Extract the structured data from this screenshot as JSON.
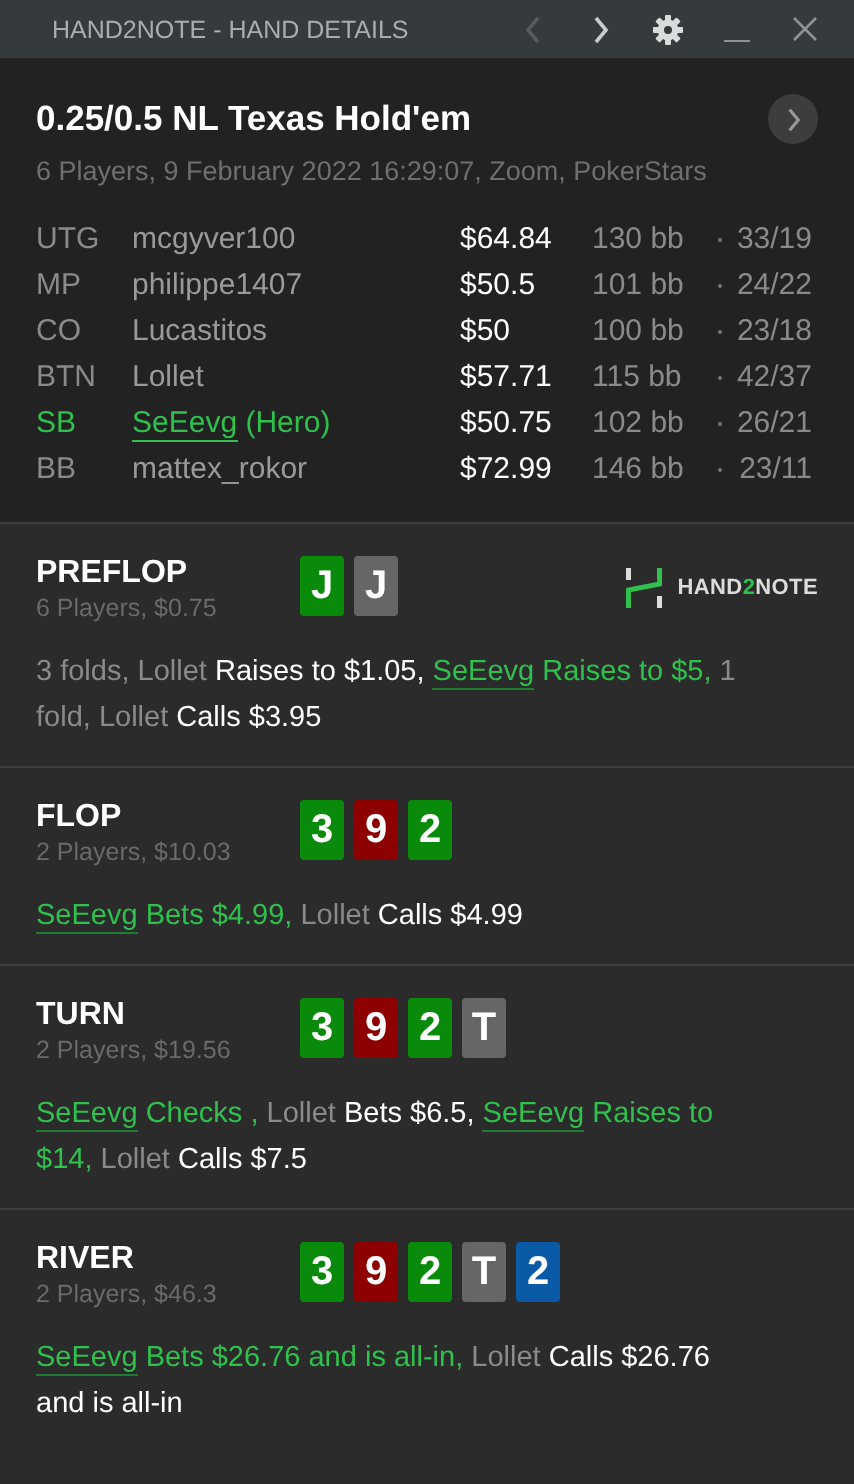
{
  "title_bar": {
    "title": "HAND2NOTE - HAND DETAILS",
    "back_disabled": true,
    "forward_disabled": false
  },
  "hand": {
    "title": "0.25/0.5 NL Texas Hold'em",
    "subtitle": "6 Players, 9 February 2022 16:29:07, Zoom, PokerStars",
    "players": [
      {
        "position": "UTG",
        "name": "mcgyver100",
        "hero": false,
        "stack": "$64.84",
        "bb": "130 bb",
        "stats": "33/19"
      },
      {
        "position": "MP",
        "name": "philippe1407",
        "hero": false,
        "stack": "$50.5",
        "bb": "101 bb",
        "stats": "24/22"
      },
      {
        "position": "CO",
        "name": "Lucastitos",
        "hero": false,
        "stack": "$50",
        "bb": "100 bb",
        "stats": "23/18"
      },
      {
        "position": "BTN",
        "name": "Lollet",
        "hero": false,
        "stack": "$57.71",
        "bb": "115 bb",
        "stats": "42/37"
      },
      {
        "position": "SB",
        "name": "SeEevg",
        "hero": true,
        "hero_tag": "(Hero)",
        "stack": "$50.75",
        "bb": "102 bb",
        "stats": "26/21"
      },
      {
        "position": "BB",
        "name": "mattex_rokor",
        "hero": false,
        "stack": "$72.99",
        "bb": "146 bb",
        "stats": "23/11"
      }
    ]
  },
  "streets": [
    {
      "name": "PREFLOP",
      "info": "6 Players, $0.75",
      "logo": {
        "parts": [
          {
            "text": "HAND",
            "accent": false
          },
          {
            "text": "2",
            "accent": true
          },
          {
            "text": "NOTE",
            "accent": false
          }
        ]
      },
      "cards": [
        {
          "rank": "J",
          "color": "#0a8a0a"
        },
        {
          "rank": "J",
          "color": "#666666"
        }
      ],
      "actions": [
        {
          "kind": "plain",
          "text": "3 folds, "
        },
        {
          "kind": "player",
          "text": "Lollet"
        },
        {
          "kind": "action",
          "text": " Raises to $1.05, "
        },
        {
          "kind": "hero_name",
          "text": "SeEevg"
        },
        {
          "kind": "hero_action",
          "text": " Raises to $5,"
        },
        {
          "kind": "plain",
          "text": " 1 fold, "
        },
        {
          "kind": "player",
          "text": "Lollet"
        },
        {
          "kind": "action",
          "text": " Calls $3.95"
        }
      ]
    },
    {
      "name": "FLOP",
      "info": "2 Players, $10.03",
      "cards": [
        {
          "rank": "3",
          "color": "#0a8a0a"
        },
        {
          "rank": "9",
          "color": "#8c0000"
        },
        {
          "rank": "2",
          "color": "#0a8a0a"
        }
      ],
      "actions": [
        {
          "kind": "hero_name",
          "text": "SeEevg"
        },
        {
          "kind": "hero_action",
          "text": " Bets $4.99,"
        },
        {
          "kind": "player",
          "text": " Lollet"
        },
        {
          "kind": "action",
          "text": " Calls $4.99"
        }
      ]
    },
    {
      "name": "TURN",
      "info": "2 Players, $19.56",
      "cards": [
        {
          "rank": "3",
          "color": "#0a8a0a"
        },
        {
          "rank": "9",
          "color": "#8c0000"
        },
        {
          "rank": "2",
          "color": "#0a8a0a"
        },
        {
          "rank": "T",
          "color": "#666666"
        }
      ],
      "actions": [
        {
          "kind": "hero_name",
          "text": "SeEevg"
        },
        {
          "kind": "hero_action",
          "text": " Checks ,"
        },
        {
          "kind": "player",
          "text": " Lollet"
        },
        {
          "kind": "action",
          "text": " Bets $6.5, "
        },
        {
          "kind": "hero_name",
          "text": "SeEevg"
        },
        {
          "kind": "hero_action",
          "text": " Raises to $14,"
        },
        {
          "kind": "player",
          "text": " Lollet"
        },
        {
          "kind": "action",
          "text": " Calls $7.5"
        }
      ]
    },
    {
      "name": "RIVER",
      "info": "2 Players, $46.3",
      "cards": [
        {
          "rank": "3",
          "color": "#0a8a0a"
        },
        {
          "rank": "9",
          "color": "#8c0000"
        },
        {
          "rank": "2",
          "color": "#0a8a0a"
        },
        {
          "rank": "T",
          "color": "#666666"
        },
        {
          "rank": "2",
          "color": "#0b5aa8"
        }
      ],
      "actions": [
        {
          "kind": "hero_name",
          "text": "SeEevg"
        },
        {
          "kind": "hero_action",
          "text": " Bets $26.76 and is all-in,"
        },
        {
          "kind": "player",
          "text": " Lollet"
        },
        {
          "kind": "action",
          "text": " Calls $26.76 and is all-in"
        }
      ]
    }
  ]
}
